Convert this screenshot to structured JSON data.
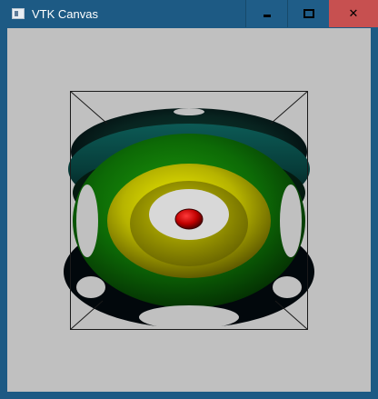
{
  "window": {
    "title": "VTK Canvas",
    "icon": "app-window-icon",
    "controls": {
      "minimize": "minimize-icon",
      "maximize": "maximize-icon",
      "close": "close-icon"
    }
  },
  "colors": {
    "titlebar": "#1d5a84",
    "close_button": "#c75050",
    "canvas_background": "#c0c0c0",
    "outline": "#1a1a1a",
    "sphere": "#d00000"
  }
}
